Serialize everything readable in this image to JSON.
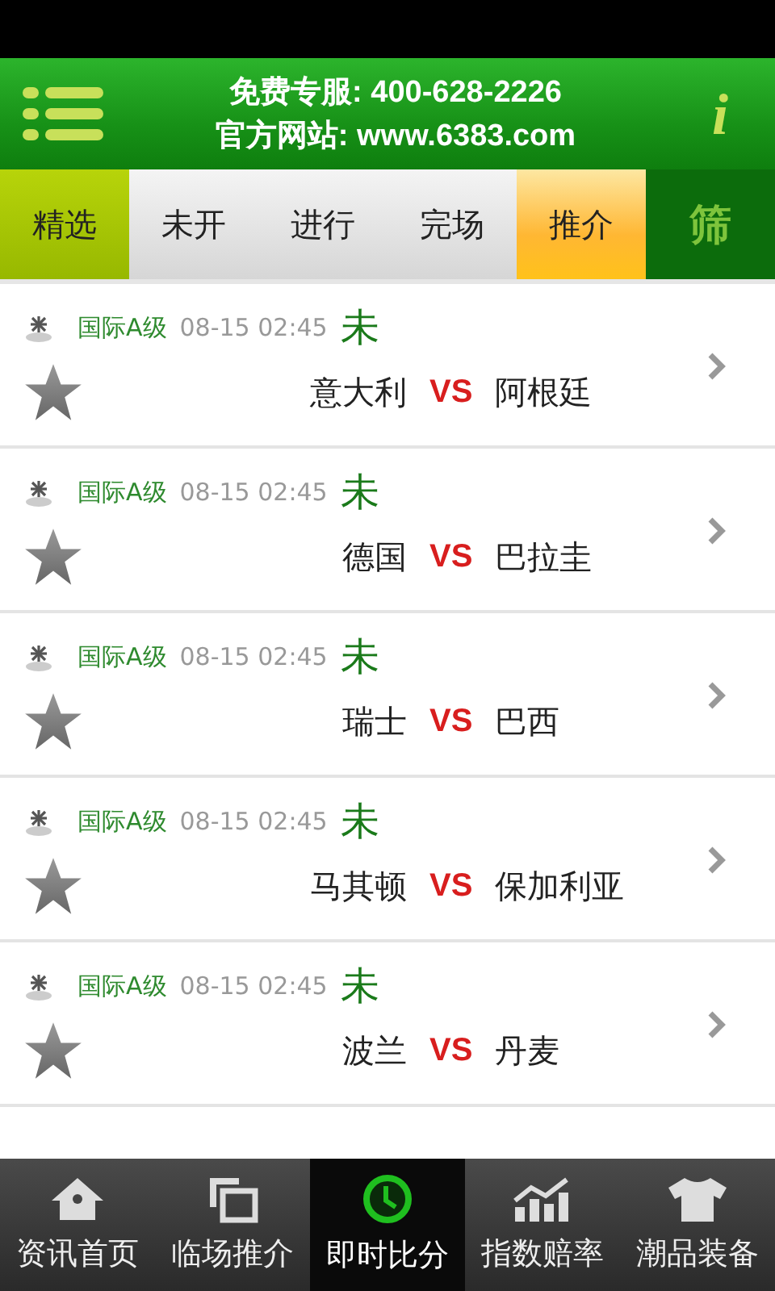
{
  "header": {
    "hotline": "免费专服: 400-628-2226",
    "website": "官方网站: www.6383.com",
    "info": "i"
  },
  "tabs": [
    {
      "label": "精选",
      "selected": true,
      "kind": "tab"
    },
    {
      "label": "未开",
      "selected": false,
      "kind": "tab"
    },
    {
      "label": "进行",
      "selected": false,
      "kind": "tab"
    },
    {
      "label": "完场",
      "selected": false,
      "kind": "tab"
    },
    {
      "label": "推介",
      "selected": false,
      "kind": "highlight"
    },
    {
      "label": "筛",
      "selected": false,
      "kind": "filter"
    }
  ],
  "matches": [
    {
      "league": "国际A级",
      "time": "08-15 02:45",
      "status": "未",
      "home": "意大利",
      "vs": "VS",
      "away": "阿根廷"
    },
    {
      "league": "国际A级",
      "time": "08-15 02:45",
      "status": "未",
      "home": "德国",
      "vs": "VS",
      "away": "巴拉圭"
    },
    {
      "league": "国际A级",
      "time": "08-15 02:45",
      "status": "未",
      "home": "瑞士",
      "vs": "VS",
      "away": "巴西"
    },
    {
      "league": "国际A级",
      "time": "08-15 02:45",
      "status": "未",
      "home": "马其顿",
      "vs": "VS",
      "away": "保加利亚"
    },
    {
      "league": "国际A级",
      "time": "08-15 02:45",
      "status": "未",
      "home": "波兰",
      "vs": "VS",
      "away": "丹麦"
    }
  ],
  "bottom_nav": [
    {
      "label": "资讯首页",
      "selected": false
    },
    {
      "label": "临场推介",
      "selected": false
    },
    {
      "label": "即时比分",
      "selected": true
    },
    {
      "label": "指数赔率",
      "selected": false
    },
    {
      "label": "潮品装备",
      "selected": false
    }
  ]
}
